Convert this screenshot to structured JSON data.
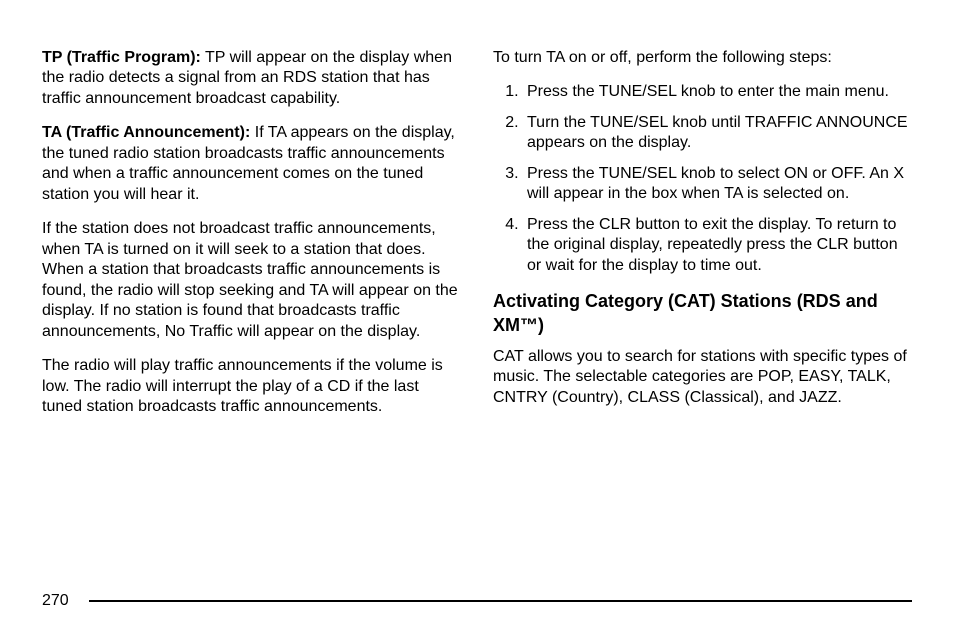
{
  "left": {
    "tp_label": "TP (Traffic Program):",
    "tp_text": "  TP will appear on the display when the radio detects a signal from an RDS station that has traffic announcement broadcast capability.",
    "ta_label": "TA (Traffic Announcement):",
    "ta_text": "  If TA appears on the display, the tuned radio station broadcasts traffic announcements and when a traffic announcement comes on the tuned station you will hear it.",
    "p3": "If the station does not broadcast traffic announcements, when TA is turned on it will seek to a station that does. When a station that broadcasts traffic announcements is found, the radio will stop seeking and TA will appear on the display. If no station is found that broadcasts traffic announcements, No Traffic will appear on the display.",
    "p4": "The radio will play traffic announcements if the volume is low. The radio will interrupt the play of a CD if the last tuned station broadcasts traffic announcements."
  },
  "right": {
    "intro": "To turn TA on or off, perform the following steps:",
    "steps": [
      "Press the TUNE/SEL knob to enter the main menu.",
      "Turn the TUNE/SEL knob until TRAFFIC ANNOUNCE appears on the display.",
      "Press the TUNE/SEL knob to select ON or OFF. An X will appear in the box when TA is selected on.",
      "Press the CLR button to exit the display. To return to the original display, repeatedly press the CLR button or wait for the display to time out."
    ],
    "heading": "Activating Category (CAT) Stations (RDS and XM™)",
    "cat_text": "CAT allows you to search for stations with specific types of music. The selectable categories are POP, EASY, TALK, CNTRY (Country), CLASS (Classical), and JAZZ."
  },
  "page_number": "270"
}
